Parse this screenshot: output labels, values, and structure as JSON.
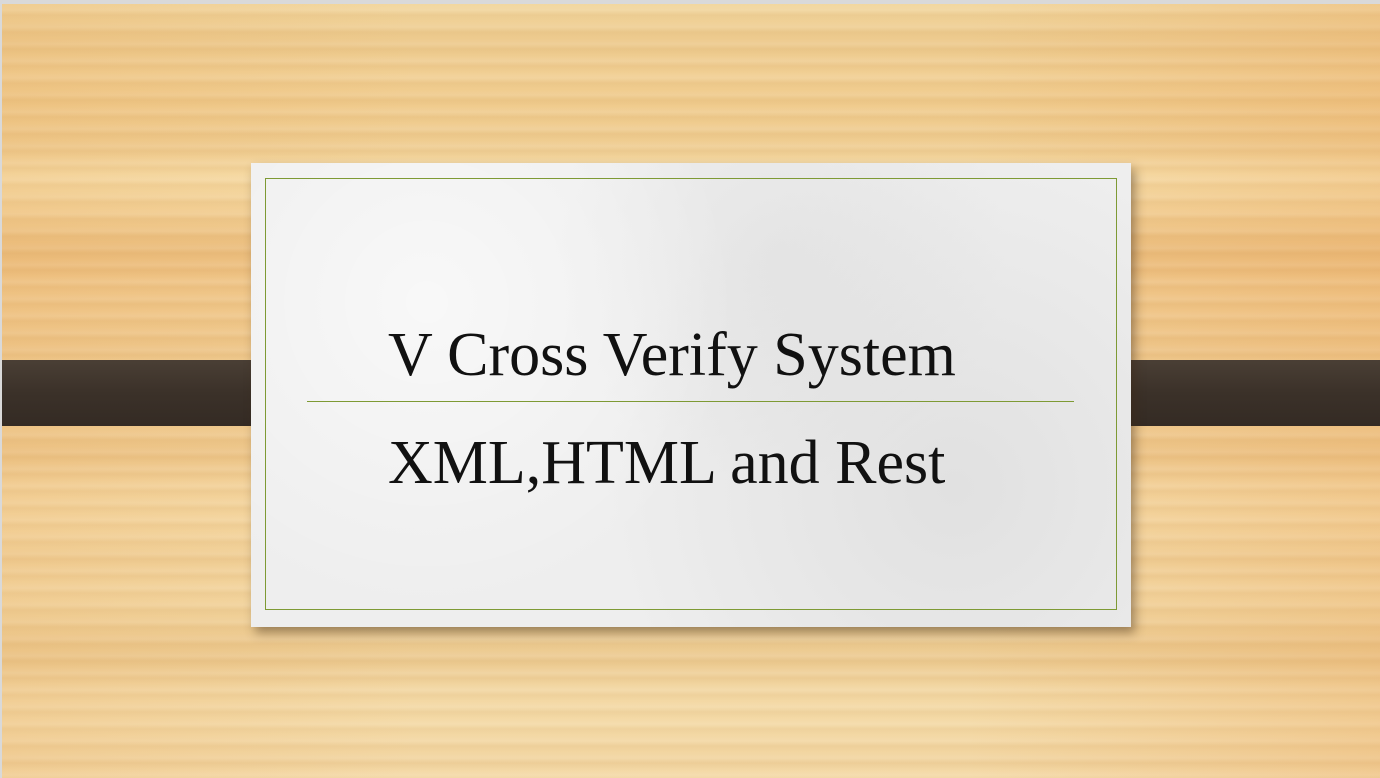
{
  "slide": {
    "title": "V Cross Verify System",
    "subtitle": "XML,HTML and Rest"
  },
  "colors": {
    "accent": "#7e9a34",
    "strap": "#3b3129",
    "card": "#eeeeee",
    "background": "#f2d29a"
  }
}
